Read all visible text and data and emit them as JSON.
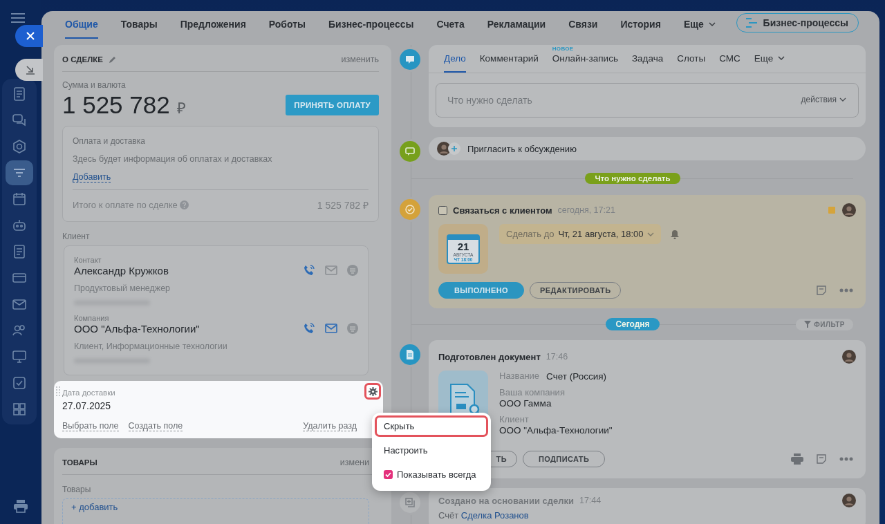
{
  "sidebar": {
    "items": [
      {
        "kind": "doc",
        "selected": false
      },
      {
        "kind": "chat",
        "selected": false
      },
      {
        "kind": "hexagon",
        "selected": false
      },
      {
        "kind": "funnel",
        "selected": true
      },
      {
        "kind": "calendar",
        "selected": false
      },
      {
        "kind": "robot",
        "selected": false
      },
      {
        "kind": "doc",
        "selected": false
      },
      {
        "kind": "card",
        "selected": false
      },
      {
        "kind": "mail",
        "selected": false
      },
      {
        "kind": "people",
        "selected": false
      },
      {
        "kind": "monitor",
        "selected": false
      },
      {
        "kind": "check",
        "selected": false
      },
      {
        "kind": "grid",
        "selected": false
      }
    ]
  },
  "tabs": [
    {
      "label": "Общие",
      "selected": true
    },
    {
      "label": "Товары",
      "selected": false
    },
    {
      "label": "Предложения",
      "selected": false
    },
    {
      "label": "Роботы",
      "selected": false
    },
    {
      "label": "Бизнес-процессы",
      "selected": false
    },
    {
      "label": "Счета",
      "selected": false
    },
    {
      "label": "Рекламации",
      "selected": false
    },
    {
      "label": "Связи",
      "selected": false
    },
    {
      "label": "История",
      "selected": false
    },
    {
      "label": "Еще",
      "selected": false,
      "kind": "more"
    }
  ],
  "process_button": "Бизнес-процессы",
  "deal": {
    "title": "О СДЕЛКЕ",
    "edit_link": "изменить",
    "amount_label": "Сумма и валюта",
    "amount": "1 525 782",
    "currency": "₽",
    "pay_button": "ПРИНЯТЬ ОПЛАТУ",
    "payment": {
      "title": "Оплата и доставка",
      "text": "Здесь будет информация об оплатах и доставках",
      "add_link": "Добавить",
      "total_label": "Итого к оплате по сделке",
      "total": "1 525 782 ₽"
    },
    "client_label": "Клиент",
    "contacts": [
      {
        "label": "Контакт",
        "name": "Александр Кружков",
        "subtitle": "Продуктовый менеджер",
        "email_active": false
      },
      {
        "label": "Компания",
        "name": "ООО \"Альфа-Технологии\"",
        "subtitle": "Клиент, Информационные технологии",
        "email_active": true
      }
    ]
  },
  "field_section": {
    "label": "Дата доставки",
    "value": "27.07.2025",
    "links": [
      "Выбрать поле",
      "Создать поле"
    ],
    "delete_link": "Удалить разд"
  },
  "products": {
    "title": "ТОВАРЫ",
    "edit_link": "измени",
    "field_label": "Товары",
    "add_link": "+ добавить"
  },
  "context_menu": {
    "items": [
      {
        "label": "Скрыть",
        "selected": true,
        "kind": "action"
      },
      {
        "label": "Настроить",
        "selected": false,
        "kind": "action"
      },
      {
        "label": "Показывать всегда",
        "selected": false,
        "kind": "checkbox",
        "checked": true
      }
    ]
  },
  "composer": {
    "tabs": [
      {
        "label": "Дело",
        "selected": true
      },
      {
        "label": "Комментарий",
        "selected": false
      },
      {
        "label": "Онлайн-запись",
        "selected": false,
        "badge": "НОВОЕ"
      },
      {
        "label": "Задача",
        "selected": false
      },
      {
        "label": "Слоты",
        "selected": false
      },
      {
        "label": "СМС",
        "selected": false
      },
      {
        "label": "Еще",
        "selected": false,
        "kind": "more"
      }
    ],
    "placeholder": "Что нужно сделать",
    "actions": "действия"
  },
  "invite": "Пригласить к обсуждению",
  "todo_divider": "Что нужно сделать",
  "task": {
    "checked": false,
    "title": "Связаться с клиентом",
    "time": "сегодня, 17:21",
    "calendar": {
      "day": "21",
      "month": "АВГУСТА",
      "time": "ЧТ 18:00"
    },
    "deadline_prefix": "Сделать до",
    "deadline": "Чт, 21 августа, 18:00",
    "buttons": [
      "ВЫПОЛНЕНО",
      "РЕДАКТИРОВАТЬ"
    ]
  },
  "today_divider": "Сегодня",
  "filter": "ФИЛЬТР",
  "document": {
    "title": "Подготовлен документ",
    "time": "17:46",
    "fields": [
      {
        "label": "Название",
        "value": "Счет (Россия)",
        "kind": "inline"
      },
      {
        "label": "Ваша компания",
        "value": "ООО Гамма",
        "kind": "stacked"
      },
      {
        "label": "Клиент",
        "value": "ООО \"Альфа-Технологии\"",
        "kind": "stacked"
      }
    ],
    "buttons": [
      "ТЬ",
      "ПОДПИСАТЬ"
    ]
  },
  "created": {
    "title": "Создано на основании сделки",
    "time": "17:44",
    "prefix": "Счёт",
    "link": "Сделка Розанов"
  }
}
